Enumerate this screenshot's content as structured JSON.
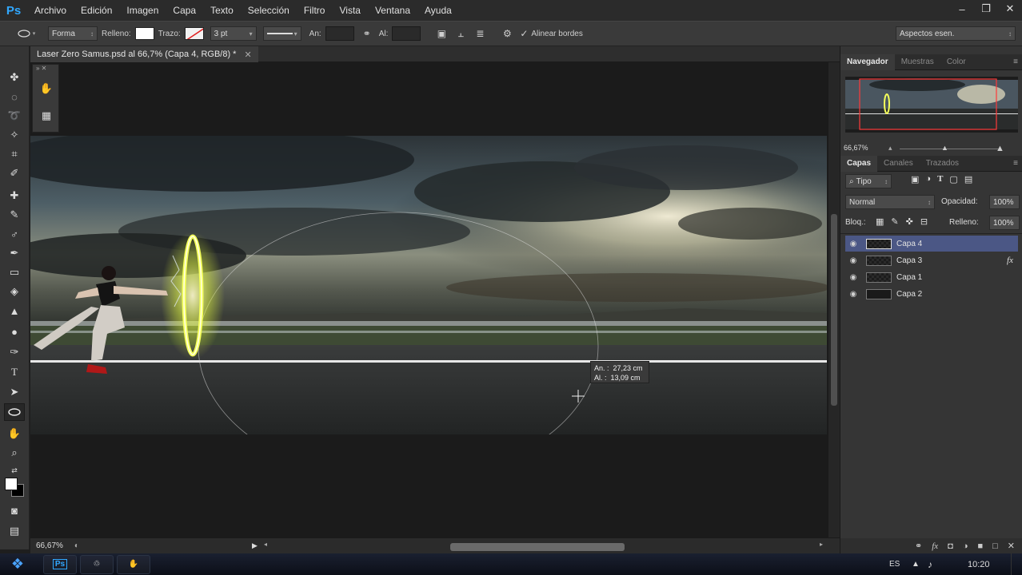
{
  "app": {
    "logo": "Ps"
  },
  "menu": [
    "Archivo",
    "Edición",
    "Imagen",
    "Capa",
    "Texto",
    "Selección",
    "Filtro",
    "Vista",
    "Ventana",
    "Ayuda"
  ],
  "options": {
    "mode": "Forma",
    "fill_label": "Relleno:",
    "stroke_label": "Trazo:",
    "stroke_width": "3 pt",
    "width_label": "An:",
    "height_label": "Al:",
    "align_edges": "Alinear bordes",
    "workspace": "Aspectos esen."
  },
  "document": {
    "tab_title": "Laser Zero Samus.psd al 66,7% (Capa 4, RGB/8) *",
    "zoom": "66,67%"
  },
  "measure": {
    "width_label": "An. :",
    "width_value": "27,23 cm",
    "height_label": "Al. :",
    "height_value": "13,09 cm"
  },
  "navigator": {
    "tabs": [
      "Navegador",
      "Muestras",
      "Color"
    ],
    "zoom": "66,67%"
  },
  "layers_panel": {
    "tabs": [
      "Capas",
      "Canales",
      "Trazados"
    ],
    "filter": "Tipo",
    "blend_mode": "Normal",
    "opacity_label": "Opacidad:",
    "opacity_value": "100%",
    "lock_label": "Bloq.:",
    "fill_label": "Relleno:",
    "fill_value": "100%",
    "layers": [
      {
        "name": "Capa 4",
        "selected": true,
        "fx": false
      },
      {
        "name": "Capa 3",
        "selected": false,
        "fx": true
      },
      {
        "name": "Capa 1",
        "selected": false,
        "fx": false
      },
      {
        "name": "Capa 2",
        "selected": false,
        "fx": false
      }
    ],
    "fx_label": "fx"
  },
  "taskbar": {
    "language": "ES",
    "time": "10:20"
  },
  "colors": {
    "accent_selection": "#4b5785",
    "ps_blue": "#31a8ff",
    "ring_yellow": "#f4ff5a"
  }
}
